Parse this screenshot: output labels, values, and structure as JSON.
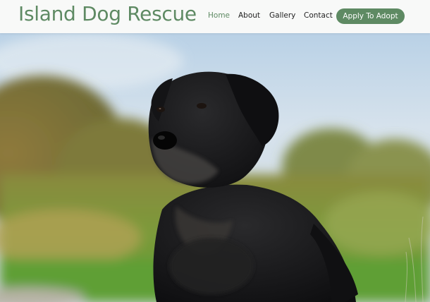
{
  "site": {
    "title": "Island Dog Rescue",
    "brand_color": "#5e8a63"
  },
  "nav": {
    "items": [
      {
        "label": "Home",
        "active": true
      },
      {
        "label": "About",
        "active": false
      },
      {
        "label": "Gallery",
        "active": false
      },
      {
        "label": "Contact",
        "active": false
      }
    ],
    "cta_label": "Apply To Adopt"
  },
  "hero": {
    "image": "black-labrador-lying-in-grass-photo"
  }
}
